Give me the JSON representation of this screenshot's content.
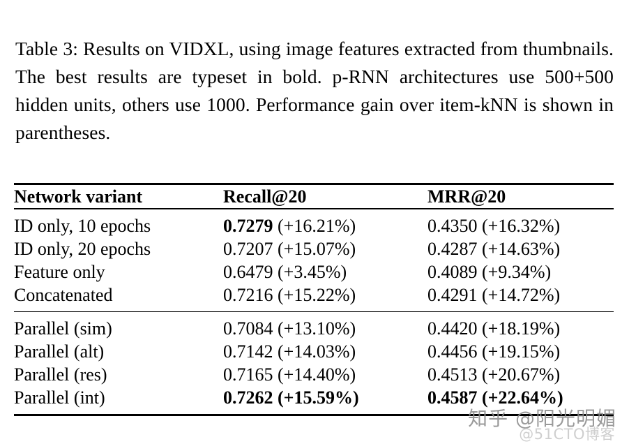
{
  "caption": {
    "label": "Table 3:",
    "text": "Table 3: Results on VIDXL, using image features extracted from thumbnails. The best results are typeset in bold. p-RNN architectures use 500+500 hidden units, others use 1000. Performance gain over item-kNN is shown in parentheses."
  },
  "table": {
    "columns": [
      "Network variant",
      "Recall@20",
      "MRR@20"
    ],
    "groups": [
      {
        "rows": [
          {
            "variant": "ID only, 10 epochs",
            "recall_value": "0.7279",
            "recall_gain": "(+16.21%)",
            "recall_value_bold": true,
            "recall_gain_bold": false,
            "mrr_value": "0.4350",
            "mrr_gain": "(+16.32%)",
            "mrr_value_bold": false,
            "mrr_gain_bold": false
          },
          {
            "variant": "ID only, 20 epochs",
            "recall_value": "0.7207",
            "recall_gain": "(+15.07%)",
            "recall_value_bold": false,
            "recall_gain_bold": false,
            "mrr_value": "0.4287",
            "mrr_gain": "(+14.63%)",
            "mrr_value_bold": false,
            "mrr_gain_bold": false
          },
          {
            "variant": "Feature only",
            "recall_value": "0.6479",
            "recall_gain": "(+3.45%)",
            "recall_value_bold": false,
            "recall_gain_bold": false,
            "mrr_value": "0.4089",
            "mrr_gain": "(+9.34%)",
            "mrr_value_bold": false,
            "mrr_gain_bold": false
          },
          {
            "variant": "Concatenated",
            "recall_value": "0.7216",
            "recall_gain": "(+15.22%)",
            "recall_value_bold": false,
            "recall_gain_bold": false,
            "mrr_value": "0.4291",
            "mrr_gain": "(+14.72%)",
            "mrr_value_bold": false,
            "mrr_gain_bold": false
          }
        ]
      },
      {
        "rows": [
          {
            "variant": "Parallel (sim)",
            "recall_value": "0.7084",
            "recall_gain": "(+13.10%)",
            "recall_value_bold": false,
            "recall_gain_bold": false,
            "mrr_value": "0.4420",
            "mrr_gain": "(+18.19%)",
            "mrr_value_bold": false,
            "mrr_gain_bold": false
          },
          {
            "variant": "Parallel (alt)",
            "recall_value": "0.7142",
            "recall_gain": "(+14.03%)",
            "recall_value_bold": false,
            "recall_gain_bold": false,
            "mrr_value": "0.4456",
            "mrr_gain": "(+19.15%)",
            "mrr_value_bold": false,
            "mrr_gain_bold": false
          },
          {
            "variant": "Parallel (res)",
            "recall_value": "0.7165",
            "recall_gain": "(+14.40%)",
            "recall_value_bold": false,
            "recall_gain_bold": false,
            "mrr_value": "0.4513",
            "mrr_gain": "(+20.67%)",
            "mrr_value_bold": false,
            "mrr_gain_bold": false
          },
          {
            "variant": "Parallel (int)",
            "recall_value": "0.7262",
            "recall_gain": "(+15.59%)",
            "recall_value_bold": true,
            "recall_gain_bold": true,
            "mrr_value": "0.4587",
            "mrr_gain": "(+22.64%)",
            "mrr_value_bold": true,
            "mrr_gain_bold": true
          }
        ]
      }
    ]
  },
  "watermarks": {
    "zhihu": "知乎 @阳光明媚",
    "cto": "@51CTO博客"
  },
  "colors": {
    "text": "#000000",
    "rule": "#000000",
    "background": "#ffffff",
    "watermark_zhihu": "#8d8d8d",
    "watermark_cto": "#cfcfcf"
  }
}
